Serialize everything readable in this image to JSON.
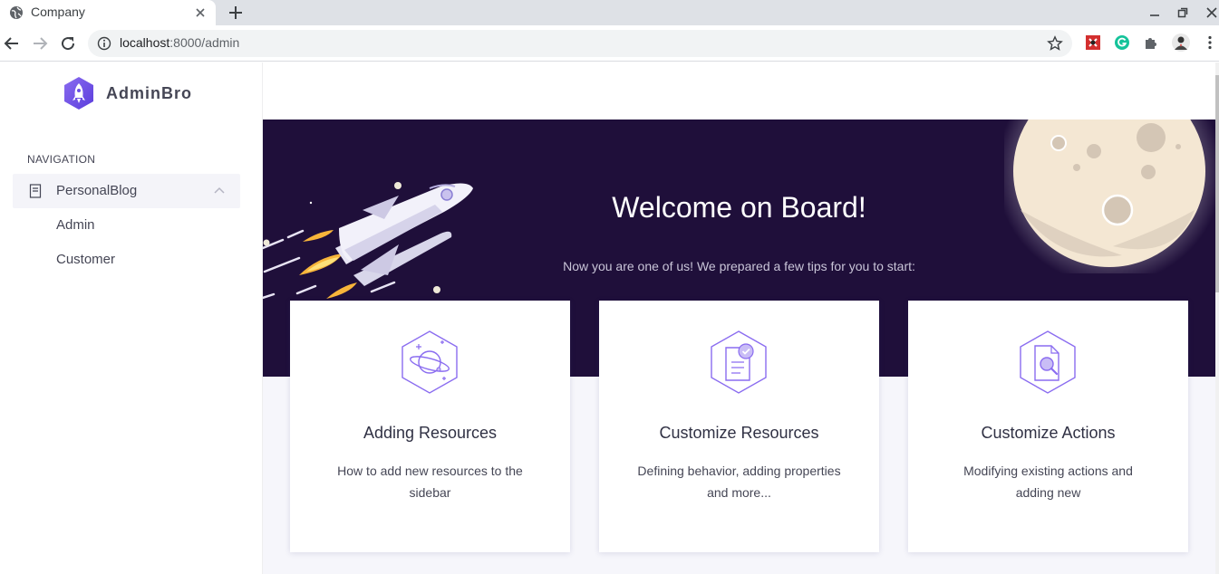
{
  "browser": {
    "tab_title": "Company",
    "url_host": "localhost",
    "url_path": ":8000/admin"
  },
  "sidebar": {
    "logo_text": "AdminBro",
    "nav_heading": "NAVIGATION",
    "group": {
      "label": "PersonalBlog",
      "items": [
        {
          "label": "Admin"
        },
        {
          "label": "Customer"
        }
      ]
    }
  },
  "hero": {
    "title": "Welcome on Board!",
    "subtitle": "Now you are one of us! We prepared a few tips for you to start:"
  },
  "cards": [
    {
      "title": "Adding Resources",
      "description": "How to add new resources to the sidebar",
      "icon": "planet-icon"
    },
    {
      "title": "Customize Resources",
      "description": "Defining behavior, adding properties and more...",
      "icon": "document-check-icon"
    },
    {
      "title": "Customize Actions",
      "description": "Modifying existing actions and adding new",
      "icon": "document-search-icon"
    }
  ],
  "colors": {
    "hero_bg": "#1f0f3a",
    "accent": "#8a6cf0",
    "brand": "#4268F6"
  }
}
